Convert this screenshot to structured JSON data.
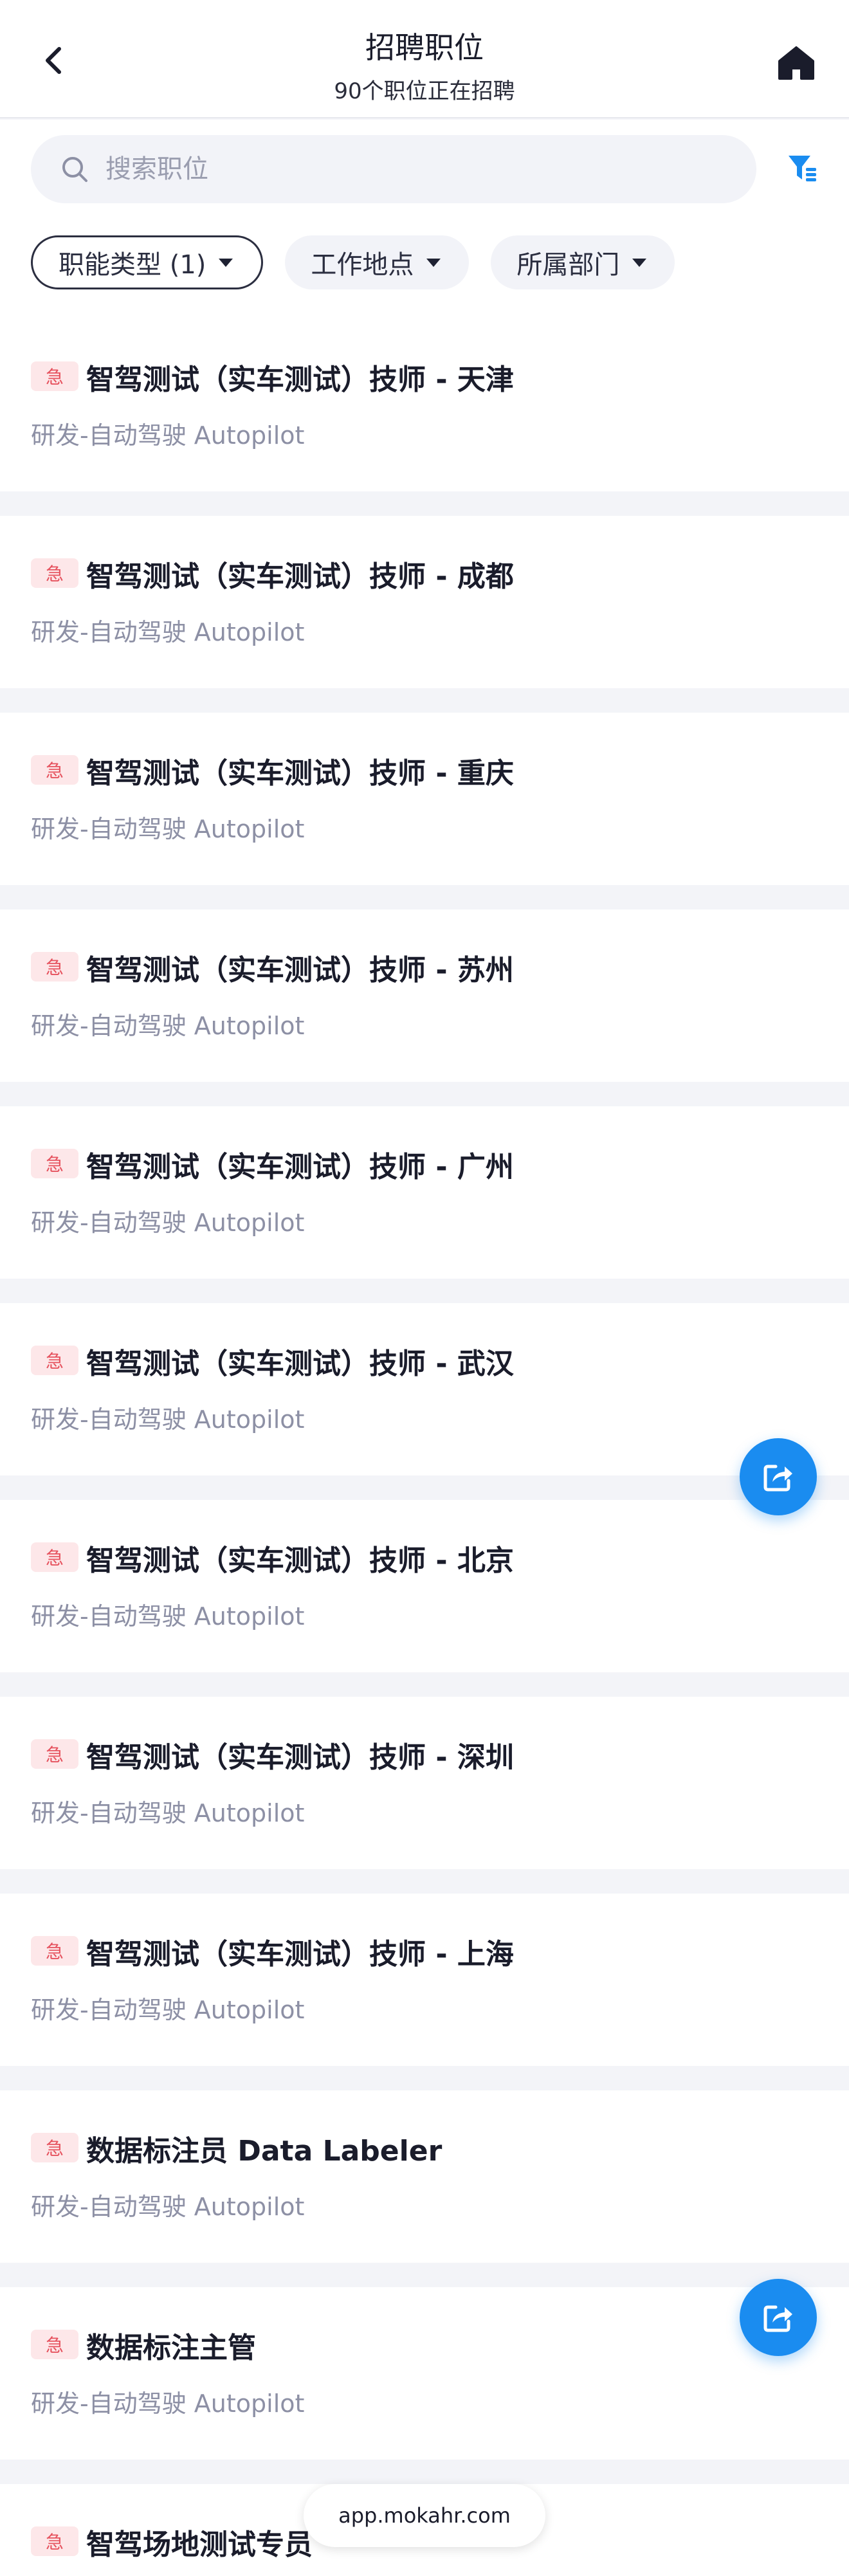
{
  "header": {
    "title": "招聘职位",
    "subtitle": "90个职位正在招聘"
  },
  "search": {
    "placeholder": "搜索职位"
  },
  "filters": [
    {
      "label": "职能类型 (1)",
      "active": true
    },
    {
      "label": "工作地点",
      "active": false
    },
    {
      "label": "所属部门",
      "active": false
    }
  ],
  "urgent_label": "急",
  "jobs": [
    {
      "title": "智驾测试（实车测试）技师 - 天津",
      "dept": "研发-自动驾驶 Autopilot"
    },
    {
      "title": "智驾测试（实车测试）技师 - 成都",
      "dept": "研发-自动驾驶 Autopilot"
    },
    {
      "title": "智驾测试（实车测试）技师 - 重庆",
      "dept": "研发-自动驾驶 Autopilot"
    },
    {
      "title": "智驾测试（实车测试）技师 - 苏州",
      "dept": "研发-自动驾驶 Autopilot"
    },
    {
      "title": "智驾测试（实车测试）技师 - 广州",
      "dept": "研发-自动驾驶 Autopilot"
    },
    {
      "title": "智驾测试（实车测试）技师 - 武汉",
      "dept": "研发-自动驾驶 Autopilot"
    },
    {
      "title": "智驾测试（实车测试）技师 - 北京",
      "dept": "研发-自动驾驶 Autopilot"
    },
    {
      "title": "智驾测试（实车测试）技师 - 深圳",
      "dept": "研发-自动驾驶 Autopilot"
    },
    {
      "title": "智驾测试（实车测试）技师 - 上海",
      "dept": "研发-自动驾驶 Autopilot"
    },
    {
      "title": "数据标注员 Data Labeler",
      "dept": "研发-自动驾驶 Autopilot"
    },
    {
      "title": "数据标注主管",
      "dept": "研发-自动驾驶 Autopilot"
    },
    {
      "title": "智驾场地测试专员",
      "dept": ""
    }
  ],
  "url_bar": {
    "text": "app.mokahr.com"
  },
  "colors": {
    "accent": "#1a8cf0",
    "urgent_bg": "#fde7e9",
    "urgent_text": "#e6525e"
  }
}
